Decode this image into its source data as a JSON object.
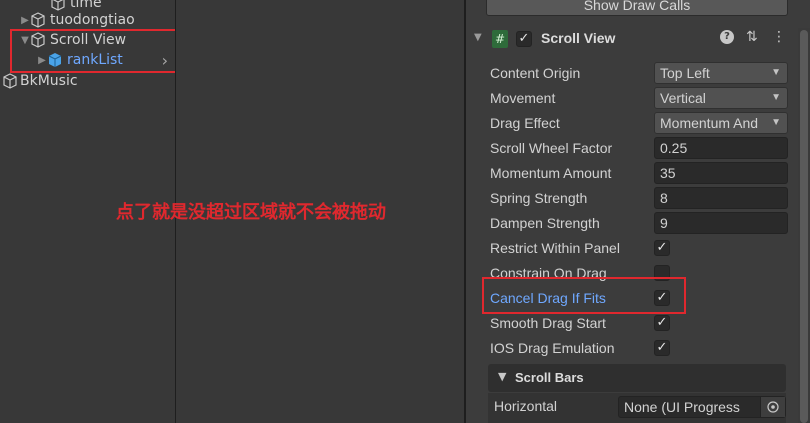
{
  "hierarchy": {
    "items": [
      {
        "label": "time"
      },
      {
        "label": "tuodongtiao"
      },
      {
        "label": "Scroll View"
      },
      {
        "label": "rankList"
      },
      {
        "label": "BkMusic"
      }
    ],
    "chevron": "›"
  },
  "annotation": {
    "text": "点了就是没超过区域就不会被拖动",
    "color": "#e0282e"
  },
  "inspector": {
    "top_button": "Show Draw Calls",
    "component": {
      "title": "Scroll View",
      "script_icon": "#",
      "help_icon": "?",
      "settings_icon": "⇅",
      "menu_icon": "⋮",
      "enabled_check": "✓"
    },
    "props": {
      "content_origin": {
        "label": "Content Origin",
        "value": "Top Left"
      },
      "movement": {
        "label": "Movement",
        "value": "Vertical"
      },
      "drag_effect": {
        "label": "Drag Effect",
        "value": "Momentum And Spring"
      },
      "scroll_wheel": {
        "label": "Scroll Wheel Factor",
        "value": "0.25"
      },
      "momentum": {
        "label": "Momentum Amount",
        "value": "35"
      },
      "spring": {
        "label": "Spring Strength",
        "value": "8"
      },
      "dampen": {
        "label": "Dampen Strength",
        "value": "9"
      },
      "restrict": {
        "label": "Restrict Within Panel",
        "checked": true
      },
      "constrain": {
        "label": "Constrain On Drag",
        "checked": false
      },
      "cancel": {
        "label": "Cancel Drag If Fits",
        "checked": true
      },
      "smooth": {
        "label": "Smooth Drag Start",
        "checked": true
      },
      "ios": {
        "label": "IOS Drag Emulation",
        "checked": true
      }
    },
    "check_glyph": "✓",
    "scroll_bars": {
      "label": "Scroll Bars",
      "arrow": "▼"
    },
    "horizontal": {
      "label": "Horizontal",
      "value": "None (UI Progress"
    }
  },
  "colors": {
    "highlight": "#e0282e",
    "link_blue": "#6fa8ff"
  }
}
